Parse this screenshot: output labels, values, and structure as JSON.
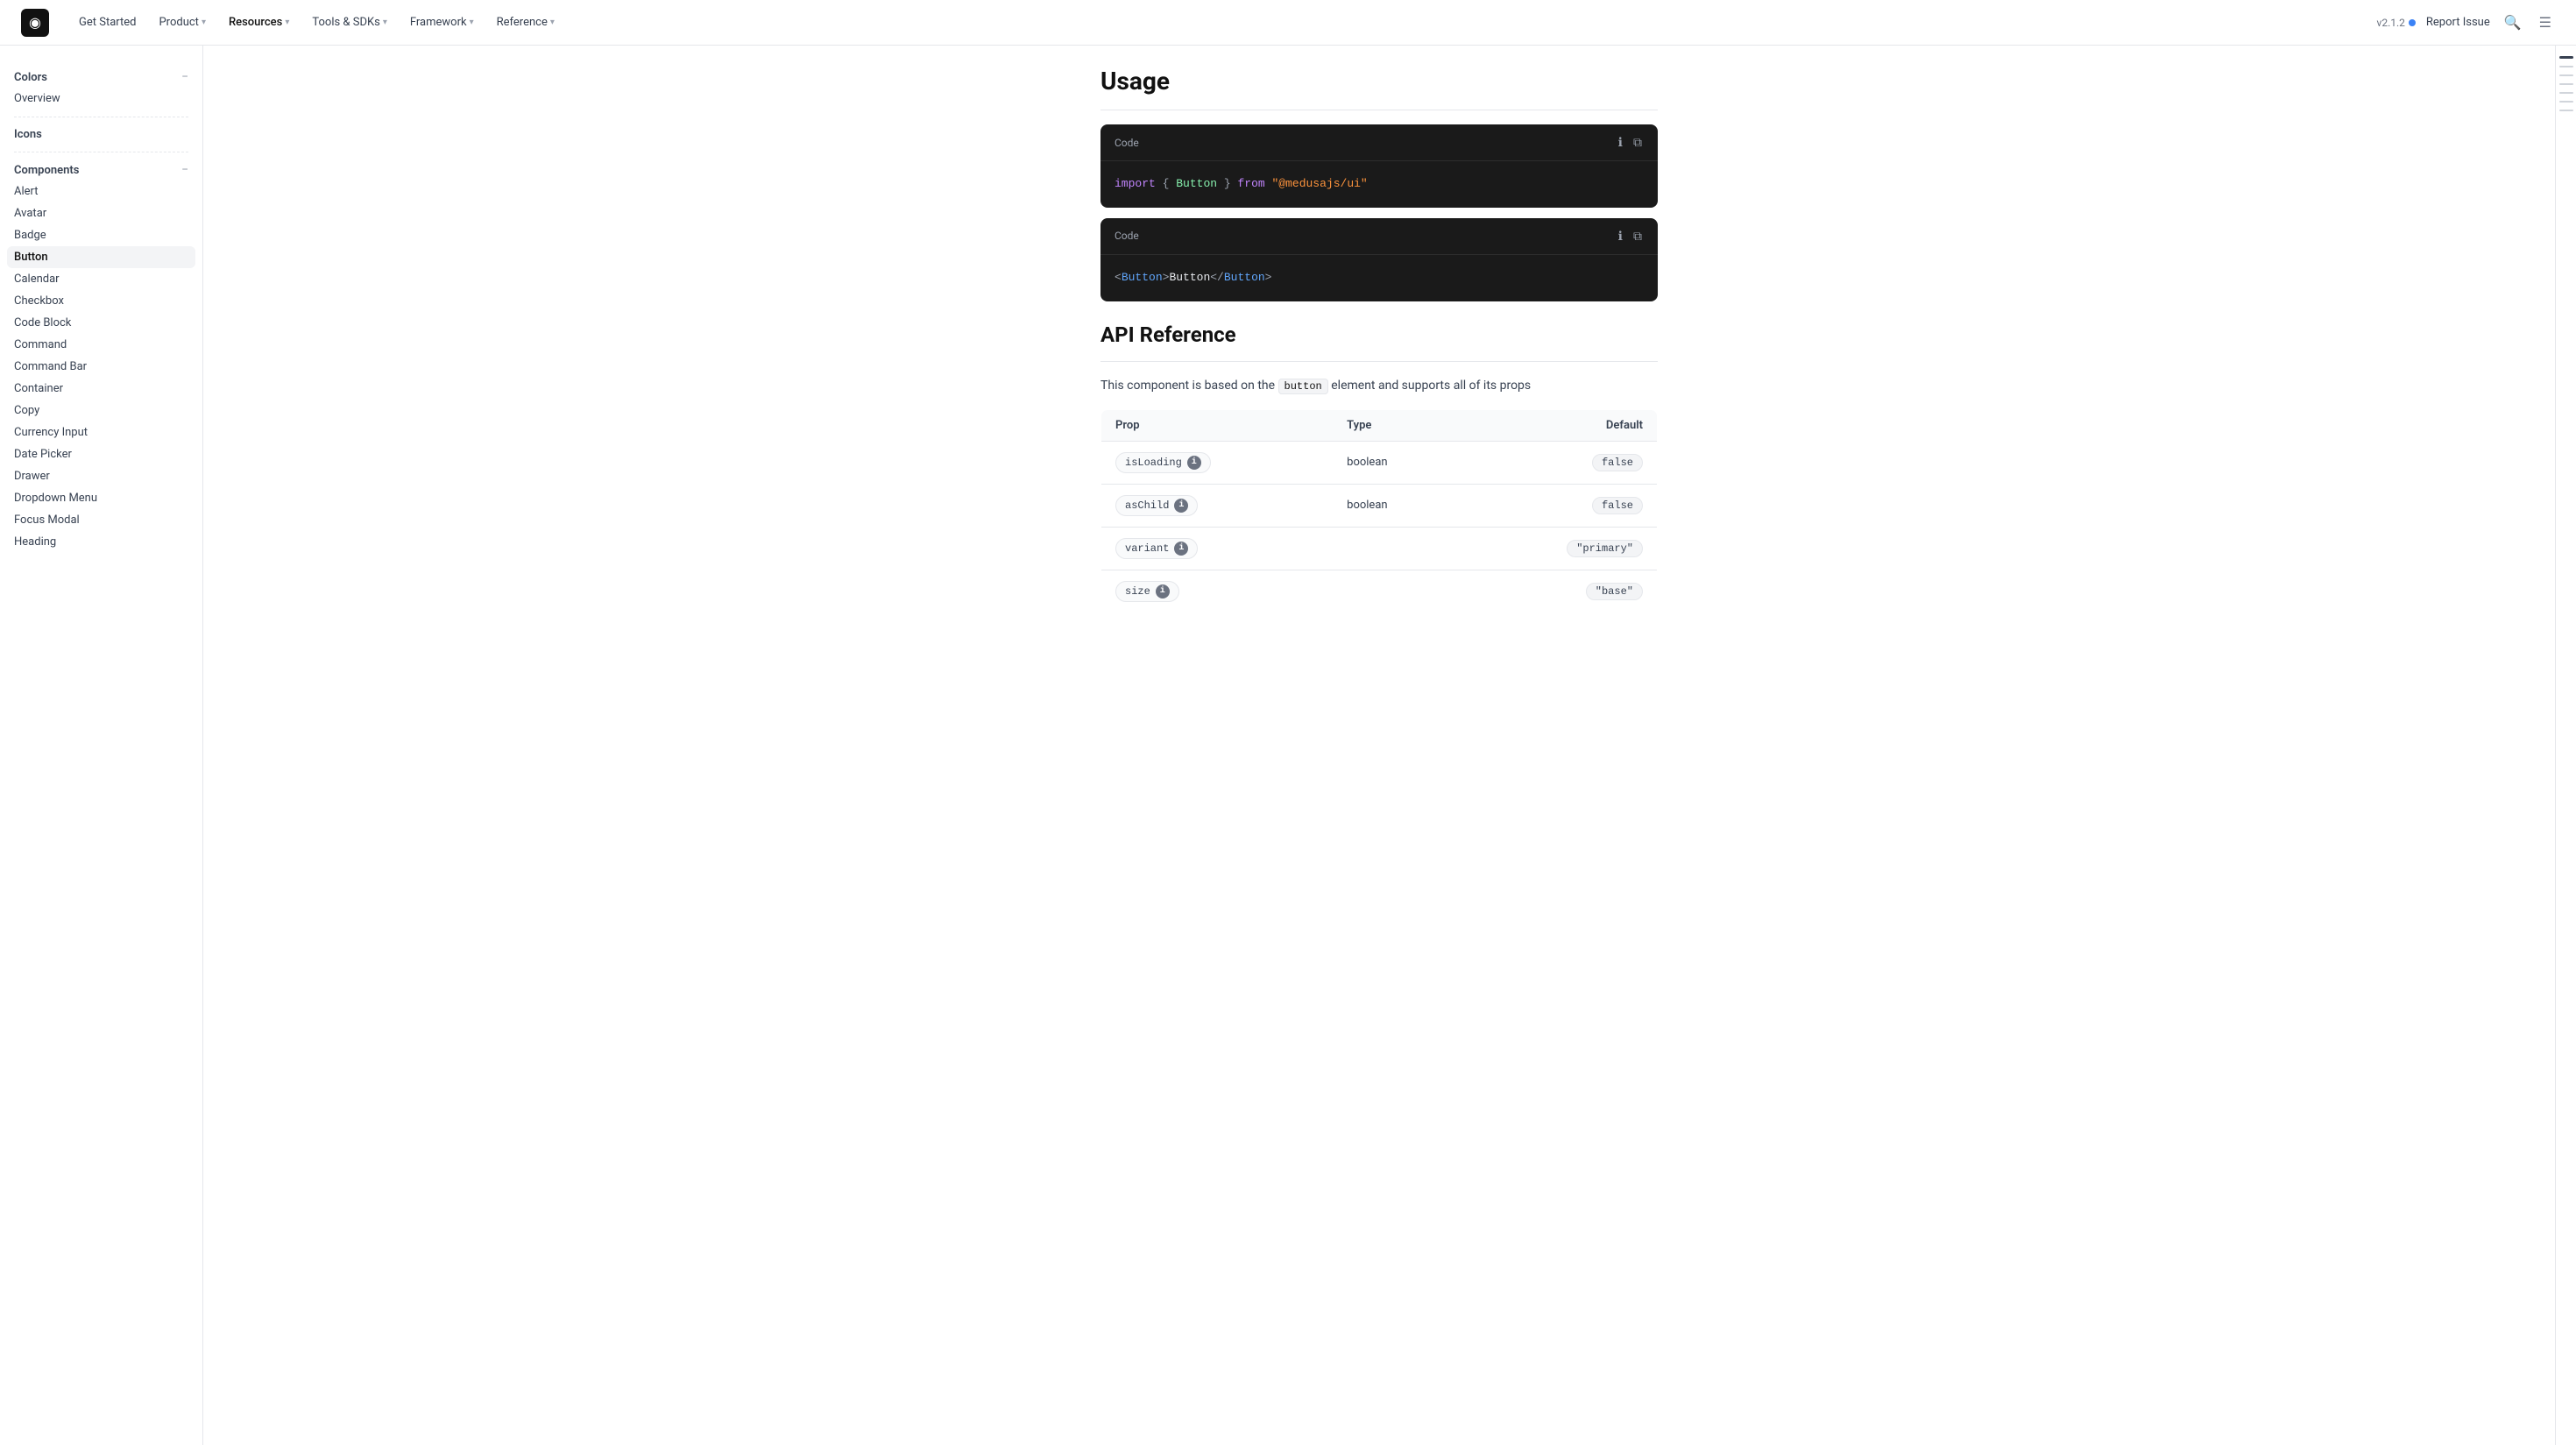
{
  "nav": {
    "logo_symbol": "◉",
    "links": [
      {
        "label": "Get Started",
        "active": false,
        "has_dropdown": false
      },
      {
        "label": "Product",
        "active": false,
        "has_dropdown": true
      },
      {
        "label": "Resources",
        "active": true,
        "has_dropdown": true
      },
      {
        "label": "Tools & SDKs",
        "active": false,
        "has_dropdown": true
      },
      {
        "label": "Framework",
        "active": false,
        "has_dropdown": true
      },
      {
        "label": "Reference",
        "active": false,
        "has_dropdown": true
      }
    ],
    "version": "v2.1.2",
    "report_label": "Report Issue"
  },
  "sidebar": {
    "sections": [
      {
        "title": "Colors",
        "collapsible": true,
        "items": [
          {
            "label": "Overview",
            "active": false
          }
        ]
      },
      {
        "title": "Icons",
        "collapsible": false,
        "items": []
      },
      {
        "title": "Components",
        "collapsible": true,
        "items": [
          {
            "label": "Alert",
            "active": false
          },
          {
            "label": "Avatar",
            "active": false
          },
          {
            "label": "Badge",
            "active": false
          },
          {
            "label": "Button",
            "active": true
          },
          {
            "label": "Calendar",
            "active": false
          },
          {
            "label": "Checkbox",
            "active": false
          },
          {
            "label": "Code Block",
            "active": false
          },
          {
            "label": "Command",
            "active": false
          },
          {
            "label": "Command Bar",
            "active": false
          },
          {
            "label": "Container",
            "active": false
          },
          {
            "label": "Copy",
            "active": false
          },
          {
            "label": "Currency Input",
            "active": false
          },
          {
            "label": "Date Picker",
            "active": false
          },
          {
            "label": "Drawer",
            "active": false
          },
          {
            "label": "Dropdown Menu",
            "active": false
          },
          {
            "label": "Focus Modal",
            "active": false
          },
          {
            "label": "Heading",
            "active": false
          }
        ]
      }
    ]
  },
  "main": {
    "usage_title": "Usage",
    "code_blocks": [
      {
        "label": "Code",
        "content_parts": [
          {
            "type": "keyword",
            "text": "import"
          },
          {
            "type": "punctuation",
            "text": " { "
          },
          {
            "type": "import_name",
            "text": "Button"
          },
          {
            "type": "punctuation",
            "text": " } "
          },
          {
            "type": "keyword",
            "text": "from"
          },
          {
            "type": "text",
            "text": " "
          },
          {
            "type": "string",
            "text": "\"@medusajs/ui\""
          }
        ]
      },
      {
        "label": "Code",
        "content_parts": [
          {
            "type": "punctuation",
            "text": "<"
          },
          {
            "type": "tag",
            "text": "Button"
          },
          {
            "type": "punctuation",
            "text": ">"
          },
          {
            "type": "text",
            "text": "Button"
          },
          {
            "type": "punctuation",
            "text": "</"
          },
          {
            "type": "tag",
            "text": "Button"
          },
          {
            "type": "punctuation",
            "text": ">"
          }
        ]
      }
    ],
    "api_ref_title": "API Reference",
    "api_description_before": "This component is based on the",
    "api_inline_code": "button",
    "api_description_after": "element and supports all of its props",
    "table": {
      "columns": [
        "Prop",
        "Type",
        "Default"
      ],
      "rows": [
        {
          "prop": "isLoading",
          "type": "boolean",
          "default": "false",
          "has_info": true
        },
        {
          "prop": "asChild",
          "type": "boolean",
          "default": "false",
          "has_info": true
        },
        {
          "prop": "variant",
          "type": "",
          "default": "\"primary\"",
          "has_info": true
        },
        {
          "prop": "size",
          "type": "",
          "default": "\"base\"",
          "has_info": true
        }
      ]
    }
  }
}
